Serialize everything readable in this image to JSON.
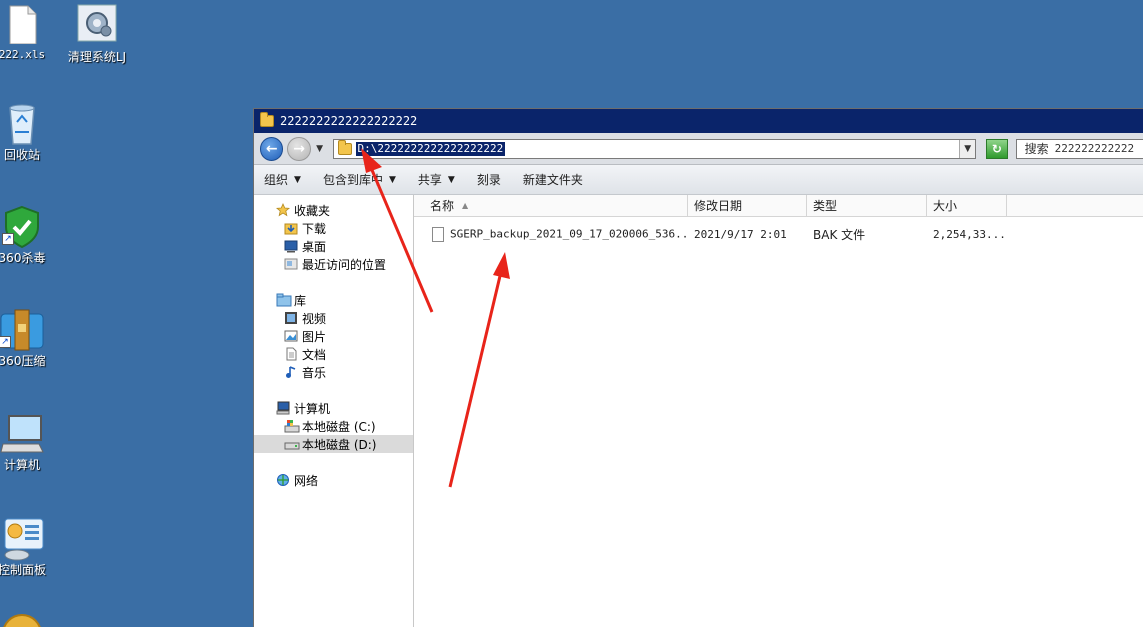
{
  "desktop": {
    "icons": [
      {
        "label": "222.xls",
        "icon": "xls-file-icon"
      },
      {
        "label": "清理系统LJ",
        "icon": "gear-icon"
      },
      {
        "label": "回收站",
        "icon": "recycle-bin-icon"
      },
      {
        "label": "360杀毒",
        "icon": "shield-icon"
      },
      {
        "label": "360压缩",
        "icon": "archive-icon"
      },
      {
        "label": "计算机",
        "icon": "computer-icon"
      },
      {
        "label": "控制面板",
        "icon": "control-panel-icon"
      }
    ]
  },
  "window": {
    "title": "2222222222222222222",
    "address": "D:\\2222222222222222222",
    "search_label": "搜索",
    "search_value": "222222222222",
    "toolbar": {
      "organize": "组织",
      "include_in_library": "包含到库中",
      "share": "共享",
      "burn": "刻录",
      "new_folder": "新建文件夹"
    },
    "nav": {
      "favorites": "收藏夹",
      "downloads": "下载",
      "desktop": "桌面",
      "recent": "最近访问的位置",
      "libraries": "库",
      "videos": "视频",
      "pictures": "图片",
      "documents": "文档",
      "music": "音乐",
      "computer": "计算机",
      "drive_c": "本地磁盘 (C:)",
      "drive_d": "本地磁盘 (D:)",
      "network": "网络"
    },
    "columns": {
      "name": "名称",
      "modified": "修改日期",
      "type": "类型",
      "size": "大小"
    },
    "files": [
      {
        "name": "SGERP_backup_2021_09_17_020006_536...",
        "modified": "2021/9/17 2:01",
        "type": "BAK 文件",
        "size": "2,254,33..."
      }
    ]
  },
  "colors": {
    "desktop_bg": "#3a6ea5",
    "titlebar": "#0a246a",
    "annotation_arrow": "#e8241a"
  }
}
